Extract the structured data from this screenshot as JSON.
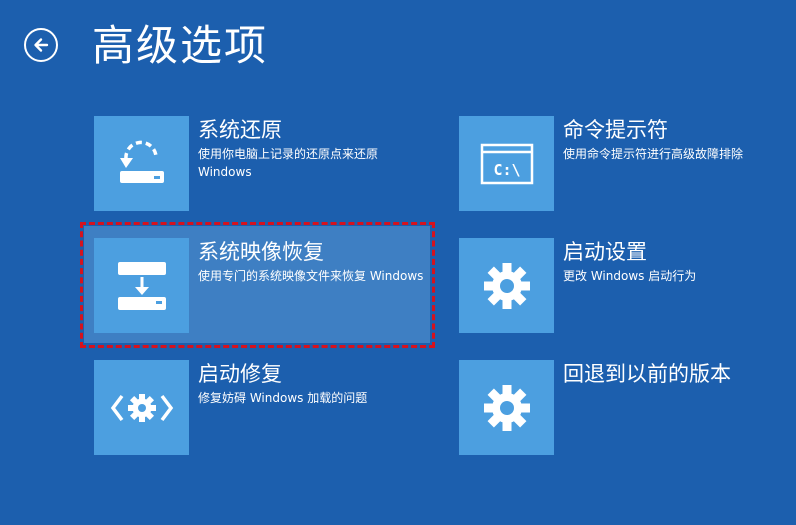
{
  "header": {
    "title": "高级选项",
    "back_icon": "back-arrow-icon"
  },
  "options": [
    {
      "title": "系统还原",
      "desc": "使用你电脑上记录的还原点来还原 Windows",
      "icon": "system-restore-icon"
    },
    {
      "title": "命令提示符",
      "desc": "使用命令提示符进行高级故障排除",
      "icon": "command-prompt-icon",
      "icon_text": "C:\\"
    },
    {
      "title": "系统映像恢复",
      "desc": "使用专门的系统映像文件来恢复 Windows",
      "icon": "system-image-recovery-icon",
      "selected": true
    },
    {
      "title": "启动设置",
      "desc": "更改 Windows 启动行为",
      "icon": "gear-icon"
    },
    {
      "title": "启动修复",
      "desc": "修复妨碍 Windows 加载的问题",
      "icon": "startup-repair-icon"
    },
    {
      "title": "回退到以前的版本",
      "desc": "",
      "icon": "gear-icon"
    }
  ],
  "colors": {
    "background": "#1c5fae",
    "tile": "#4c9fe0",
    "selected_background": "#3e7fc3",
    "focus_frame": "#d6121e"
  }
}
